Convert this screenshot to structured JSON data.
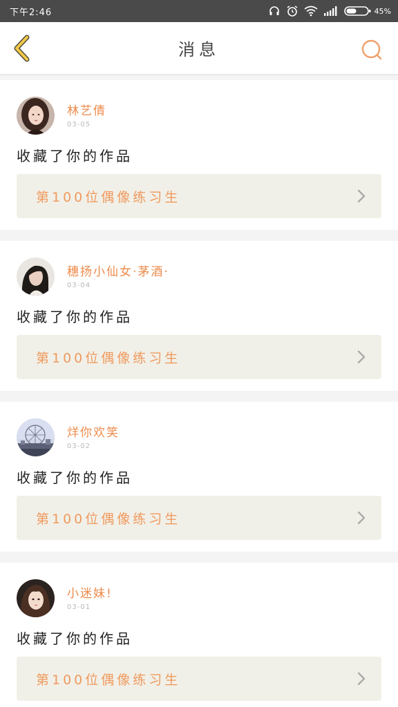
{
  "status_bar": {
    "time": "下午2:46",
    "battery": "45%"
  },
  "header": {
    "title": "消息"
  },
  "colors": {
    "accent": "#ee8a4a",
    "back_arrow": "#f4c84a",
    "card_link_bg": "#f1f0e8"
  },
  "icons": {
    "back": "chevron-left-icon",
    "search": "search-icon",
    "chevron": "chevron-right-icon"
  },
  "messages": [
    {
      "username": "林艺倩",
      "date": "03-05",
      "action": "收藏了你的作品",
      "work_title": "第100位偶像练习生",
      "avatar": "portrait-girl"
    },
    {
      "username": "穗扬小仙女·茅酒·",
      "date": "03-04",
      "action": "收藏了你的作品",
      "work_title": "第100位偶像练习生",
      "avatar": "portrait-dark-hair"
    },
    {
      "username": "烊你欢笑",
      "date": "03-02",
      "action": "收藏了你的作品",
      "work_title": "第100位偶像练习生",
      "avatar": "ferris-wheel"
    },
    {
      "username": "小迷妹!",
      "date": "03-01",
      "action": "收藏了你的作品",
      "work_title": "第100位偶像练习生",
      "avatar": "portrait-selfie"
    }
  ]
}
